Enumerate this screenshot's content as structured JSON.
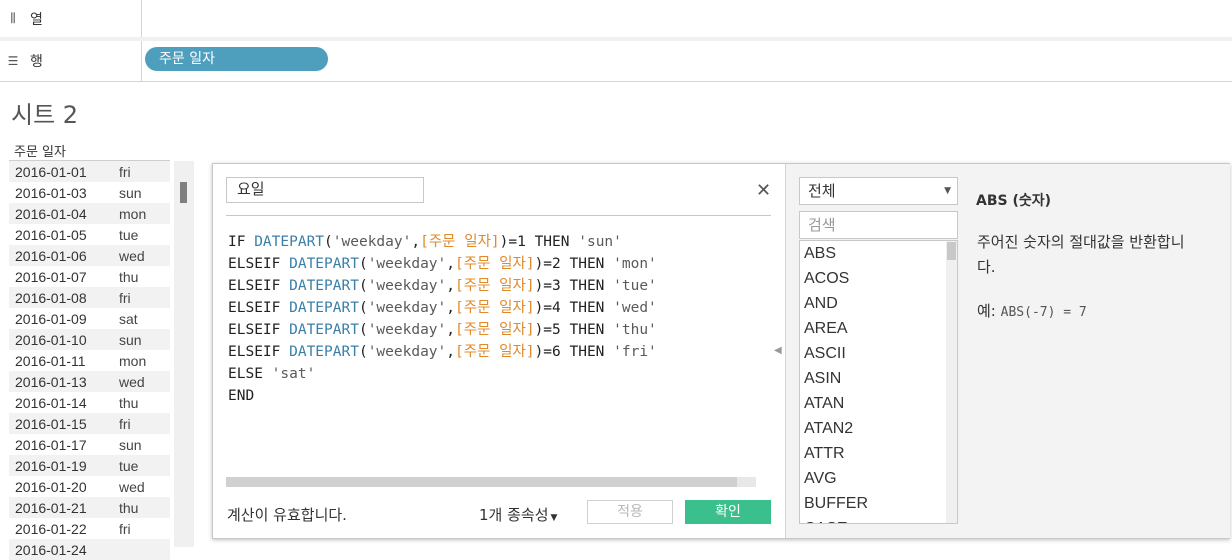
{
  "shelves": {
    "columns": {
      "icon": "columns-icon",
      "label": "열"
    },
    "rows": {
      "icon": "rows-icon",
      "label": "행",
      "pill": "주문 일자"
    }
  },
  "sheet": {
    "title": "시트 2",
    "column_header": "주문 일자",
    "rows": [
      {
        "date": "2016-01-01",
        "weekday": "fri"
      },
      {
        "date": "2016-01-03",
        "weekday": "sun"
      },
      {
        "date": "2016-01-04",
        "weekday": "mon"
      },
      {
        "date": "2016-01-05",
        "weekday": "tue"
      },
      {
        "date": "2016-01-06",
        "weekday": "wed"
      },
      {
        "date": "2016-01-07",
        "weekday": "thu"
      },
      {
        "date": "2016-01-08",
        "weekday": "fri"
      },
      {
        "date": "2016-01-09",
        "weekday": "sat"
      },
      {
        "date": "2016-01-10",
        "weekday": "sun"
      },
      {
        "date": "2016-01-11",
        "weekday": "mon"
      },
      {
        "date": "2016-01-13",
        "weekday": "wed"
      },
      {
        "date": "2016-01-14",
        "weekday": "thu"
      },
      {
        "date": "2016-01-15",
        "weekday": "fri"
      },
      {
        "date": "2016-01-17",
        "weekday": "sun"
      },
      {
        "date": "2016-01-19",
        "weekday": "tue"
      },
      {
        "date": "2016-01-20",
        "weekday": "wed"
      },
      {
        "date": "2016-01-21",
        "weekday": "thu"
      },
      {
        "date": "2016-01-22",
        "weekday": "fri"
      },
      {
        "date": "2016-01-24",
        "weekday": ""
      }
    ]
  },
  "calc_dialog": {
    "name": "요일",
    "close_icon": "close-icon",
    "formula": {
      "field": "[주문 일자]",
      "fn": "DATEPART",
      "part": "'weekday'",
      "lines": [
        {
          "kw": "IF ",
          "num": "1",
          "ret": "'sun'"
        },
        {
          "kw": "ELSEIF ",
          "num": "2",
          "ret": "'mon'"
        },
        {
          "kw": "ELSEIF ",
          "num": "3",
          "ret": "'tue'"
        },
        {
          "kw": "ELSEIF ",
          "num": "4",
          "ret": "'wed'"
        },
        {
          "kw": "ELSEIF ",
          "num": "5",
          "ret": "'thu'"
        },
        {
          "kw": "ELSEIF ",
          "num": "6",
          "ret": "'fri'"
        }
      ],
      "else_kw": "ELSE ",
      "else_val": "'sat'",
      "end_kw": "END",
      "then_kw": "THEN"
    },
    "status": "계산이 유효합니다.",
    "dependencies": "1개 종속성",
    "apply_label": "적용",
    "ok_label": "확인",
    "function_panel": {
      "category": "전체",
      "search_placeholder": "검색",
      "functions": [
        "ABS",
        "ACOS",
        "AND",
        "AREA",
        "ASCII",
        "ASIN",
        "ATAN",
        "ATAN2",
        "ATTR",
        "AVG",
        "BUFFER",
        "CASE"
      ],
      "help_title": "ABS (숫자)",
      "help_description": "주어진 숫자의 절대값을 반환합니다.",
      "help_example_label": "예:",
      "help_example_code": "ABS(-7) = 7"
    },
    "colors": {
      "accent": "#4e9fbe",
      "ok": "#3bbf8c",
      "field": "#e08a2a",
      "function": "#3a7fa8"
    }
  }
}
